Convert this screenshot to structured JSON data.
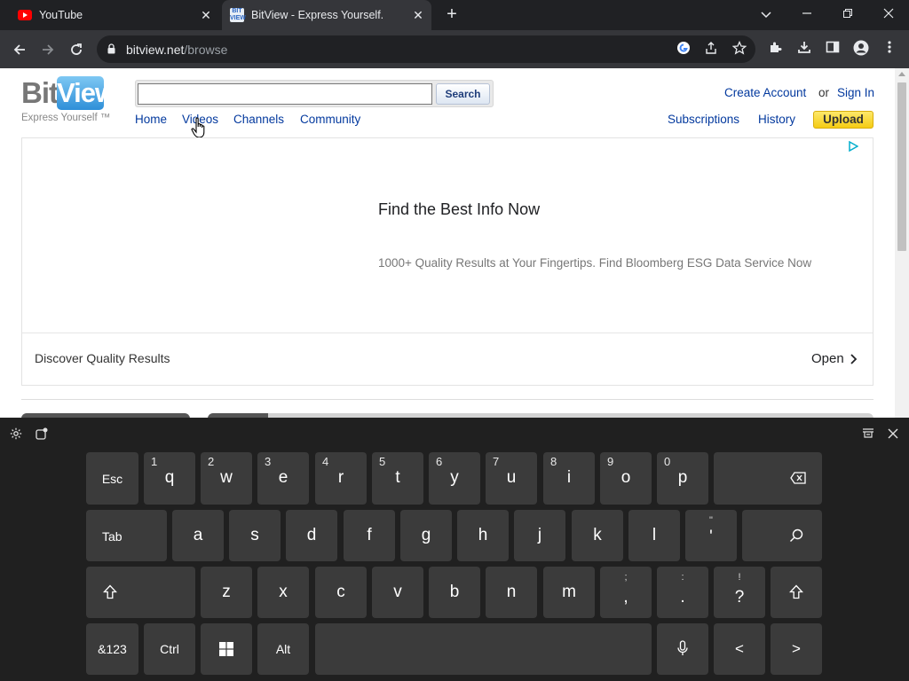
{
  "browser": {
    "tabs": [
      {
        "title": "YouTube",
        "icon": "youtube-icon",
        "active": false
      },
      {
        "title": "BitView - Express Yourself.",
        "icon": "bitview-favicon",
        "active": true
      }
    ],
    "url_host": "bitview.net",
    "url_path": "/browse"
  },
  "site": {
    "logo_bit": "Bit",
    "logo_view": "View",
    "tagline": "Express Yourself ™",
    "search_placeholder": "",
    "search_button": "Search",
    "nav": {
      "home": "Home",
      "videos": "Videos",
      "channels": "Channels",
      "community": "Community"
    },
    "account": {
      "create": "Create Account",
      "or": "or",
      "signin": "Sign In"
    },
    "user_nav": {
      "subscriptions": "Subscriptions",
      "history": "History",
      "upload": "Upload"
    }
  },
  "ad": {
    "headline": "Find the Best Info Now",
    "description": "1000+ Quality Results at Your Fingertips. Find Bloomberg ESG Data Service Now",
    "footer": "Discover Quality Results",
    "open": "Open"
  },
  "keyboard": {
    "row1": [
      {
        "key": "Esc"
      },
      {
        "key": "q",
        "hint": "1"
      },
      {
        "key": "w",
        "hint": "2"
      },
      {
        "key": "e",
        "hint": "3"
      },
      {
        "key": "r",
        "hint": "4"
      },
      {
        "key": "t",
        "hint": "5"
      },
      {
        "key": "y",
        "hint": "6"
      },
      {
        "key": "u",
        "hint": "7"
      },
      {
        "key": "i",
        "hint": "8"
      },
      {
        "key": "o",
        "hint": "9"
      },
      {
        "key": "p",
        "hint": "0"
      }
    ],
    "row2": [
      "Tab",
      "a",
      "s",
      "d",
      "f",
      "g",
      "h",
      "j",
      "k",
      "l"
    ],
    "apostrophe": {
      "top": "\"",
      "main": "'"
    },
    "row3": [
      "z",
      "x",
      "c",
      "v",
      "b",
      "n",
      "m"
    ],
    "comma": {
      "top": ";",
      "main": ","
    },
    "period": {
      "top": ":",
      "main": "."
    },
    "question": {
      "top": "!",
      "main": "?"
    },
    "row4": {
      "sym": "&123",
      "ctrl": "Ctrl",
      "alt": "Alt",
      "left": "<",
      "right": ">"
    }
  }
}
